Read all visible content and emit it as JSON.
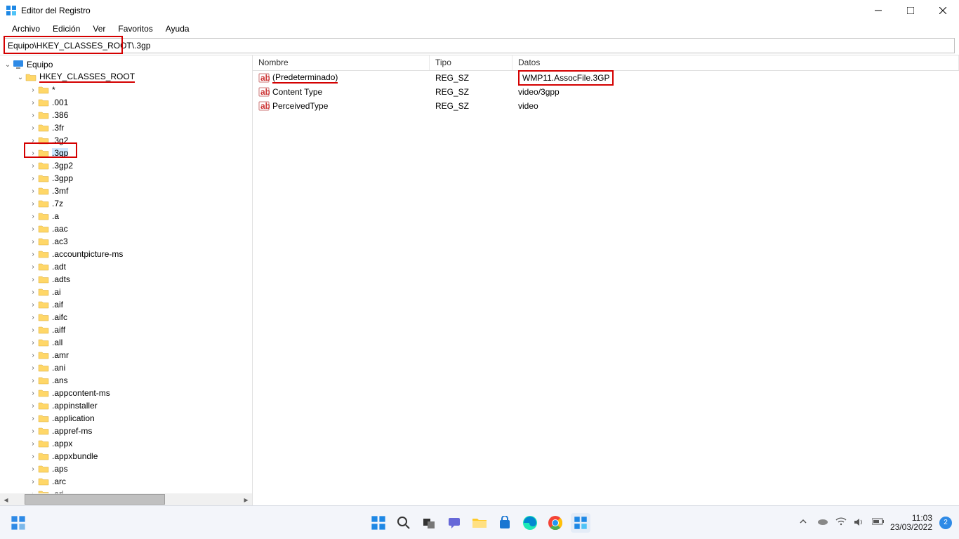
{
  "title": "Editor del Registro",
  "menus": [
    "Archivo",
    "Edición",
    "Ver",
    "Favoritos",
    "Ayuda"
  ],
  "address": "Equipo\\HKEY_CLASSES_ROOT\\.3gp",
  "address_highlight_width": 170,
  "tree": {
    "root": "Equipo",
    "hive": "HKEY_CLASSES_ROOT",
    "items": [
      "*",
      ".001",
      ".386",
      ".3fr",
      ".3g2",
      ".3gp",
      ".3gp2",
      ".3gpp",
      ".3mf",
      ".7z",
      ".a",
      ".aac",
      ".ac3",
      ".accountpicture-ms",
      ".adt",
      ".adts",
      ".ai",
      ".aif",
      ".aifc",
      ".aiff",
      ".all",
      ".amr",
      ".ani",
      ".ans",
      ".appcontent-ms",
      ".appinstaller",
      ".application",
      ".appref-ms",
      ".appx",
      ".appxbundle",
      ".aps",
      ".arc",
      ".ari"
    ],
    "selected": ".3gp"
  },
  "columns": {
    "name": "Nombre",
    "type": "Tipo",
    "data": "Datos"
  },
  "values": [
    {
      "name": "(Predeterminado)",
      "type": "REG_SZ",
      "data": "WMP11.AssocFile.3GP",
      "underline_name": true,
      "box_data": true
    },
    {
      "name": "Content Type",
      "type": "REG_SZ",
      "data": "video/3gpp"
    },
    {
      "name": "PerceivedType",
      "type": "REG_SZ",
      "data": "video"
    }
  ],
  "taskbar": {
    "time": "11:03",
    "date": "23/03/2022",
    "notif": "2"
  }
}
